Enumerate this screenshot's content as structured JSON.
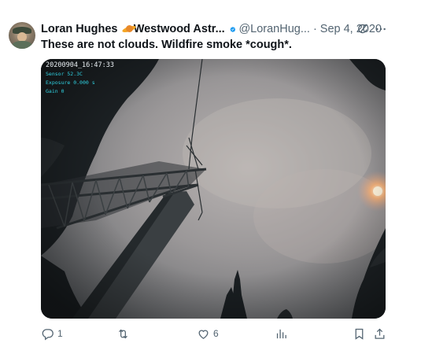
{
  "author": {
    "display_name": "Loran Hughes",
    "badge_icon": "saturn-icon",
    "org_name": "Westwood Astr...",
    "verified_icon": "verified-check-icon",
    "handle": "@LoranHug...",
    "separator": "·",
    "date": "Sep 4, 2020"
  },
  "tweet": {
    "text": "These are not clouds. Wildfire smoke *cough*."
  },
  "media": {
    "overlay": {
      "timestamp": "20200904_16:47:33",
      "sensor": "Sensor 52.3C",
      "exposure": "Exposure 0.000 s",
      "gain": "Gain 0"
    }
  },
  "actions": {
    "reply_count": "1",
    "repost_count": "",
    "like_count": "6"
  },
  "colors": {
    "accent": "#1d9bf0",
    "secondary_text": "#536471",
    "overlay_cyan": "#2fd0e0"
  }
}
